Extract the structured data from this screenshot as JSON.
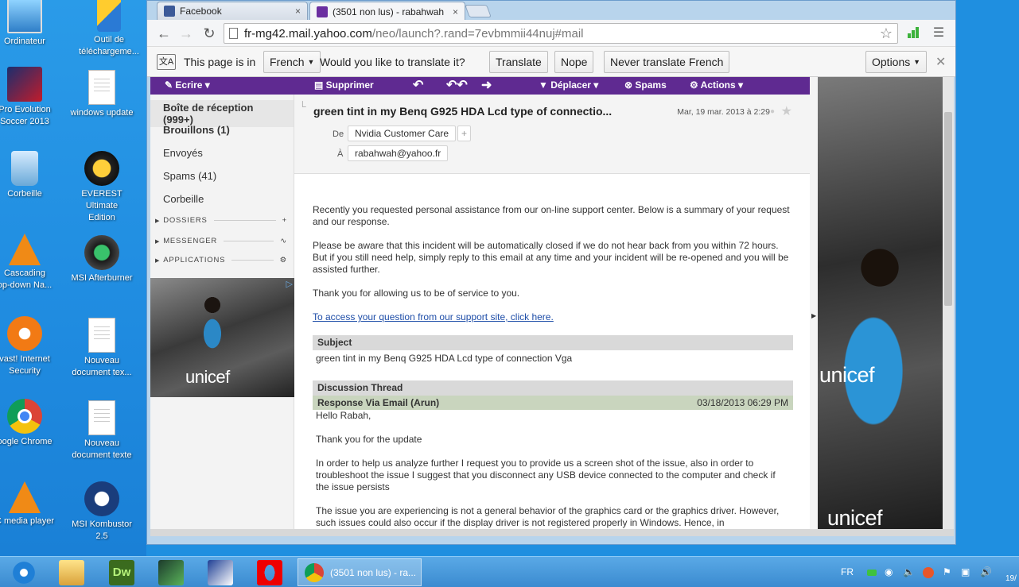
{
  "desktop": {
    "icons": [
      {
        "label": "Ordinateur",
        "icon": "computer-icon"
      },
      {
        "label": "Outil de\ntéléchargeme...",
        "icon": "download-tool-icon"
      },
      {
        "label": "Pro Evolution\nSoccer 2013",
        "icon": "pes-icon"
      },
      {
        "label": "windows update",
        "icon": "document-icon"
      },
      {
        "label": "Corbeille",
        "icon": "recycle-bin-icon"
      },
      {
        "label": "EVEREST Ultimate\nEdition",
        "icon": "everest-icon"
      },
      {
        "label": "Cascading\nop-down Na...",
        "icon": "vlc-cone-icon"
      },
      {
        "label": "MSI Afterburner",
        "icon": "msi-afterburner-icon"
      },
      {
        "label": "vast! Internet\nSecurity",
        "icon": "avast-icon"
      },
      {
        "label": "Nouveau\ndocument tex...",
        "icon": "document-icon"
      },
      {
        "label": "oogle Chrome",
        "icon": "chrome-icon"
      },
      {
        "label": "Nouveau\ndocument texte",
        "icon": "document-icon"
      },
      {
        "label": "C media player",
        "icon": "vlc-cone-icon"
      },
      {
        "label": "MSI Kombustor\n2.5",
        "icon": "msi-kombustor-icon"
      }
    ]
  },
  "browser": {
    "tabs": [
      {
        "title": "Facebook",
        "close": "×"
      },
      {
        "title": "(3501 non lus) - rabahwah",
        "close": "×"
      }
    ],
    "url_host": "fr-mg42.mail.yahoo.com",
    "url_path": "/neo/launch?.rand=7evbmmii44nuj#mail",
    "translate": {
      "prefix": "This page is in",
      "language": "French",
      "question": "Would you like to translate it?",
      "translate_btn": "Translate",
      "nope_btn": "Nope",
      "never_btn": "Never translate French",
      "options_btn": "Options"
    }
  },
  "mail": {
    "toolbar": {
      "compose": "Ecrire",
      "delete": "Supprimer",
      "move": "Déplacer",
      "spam": "Spams",
      "actions": "Actions"
    },
    "folders": [
      {
        "label": "Boîte de réception (999+)"
      },
      {
        "label": "Brouillons (1)"
      },
      {
        "label": "Envoyés"
      },
      {
        "label": "Spams (41)"
      },
      {
        "label": "Corbeille"
      }
    ],
    "sections": [
      "DOSSIERS",
      "MESSENGER",
      "APPLICATIONS"
    ],
    "ad_logo": "unicef",
    "message": {
      "subject": "green tint in my Benq G925 HDA Lcd type of connectio...",
      "date": "Mar, 19 mar. 2013 à 2:29",
      "from_label": "De",
      "from": "Nvidia Customer Care",
      "to_label": "À",
      "to": "rabahwah@yahoo.fr",
      "p1": "Recently you requested personal assistance from our on-line support center. Below is a summary of your request and our response.",
      "p2": "Please be aware that this incident will be automatically closed if we do not hear back from you within 72 hours. But if you still need help, simply reply to this email at any time and your incident will be re-opened and you will be assisted further.",
      "p3": "Thank you for allowing us to be of service to you.",
      "link": "To access your question from our support site, click here.",
      "subject_band": "Subject",
      "subject_text": "green tint in my Benq G925 HDA Lcd type of connection Vga",
      "thread_band": "Discussion Thread",
      "response_label": "Response Via Email (Arun)",
      "response_time": "03/18/2013 06:29 PM",
      "greeting": "Hello Rabah,",
      "thanks": "Thank you for the update",
      "p4": "In order to help us analyze further I request you to provide us a screen shot of the issue, also in order to troubleshoot the issue I suggest that you disconnect any USB device connected to the computer and check if the issue persists",
      "p5": "The issue you are experiencing is not a general behavior of the graphics card or the graphics driver. However, such issues could also occur if the display driver is not registered properly in Windows. Hence, in"
    }
  },
  "taskbar": {
    "task_label": "(3501 non lus) - ra...",
    "lang": "FR",
    "clock": "19/"
  }
}
